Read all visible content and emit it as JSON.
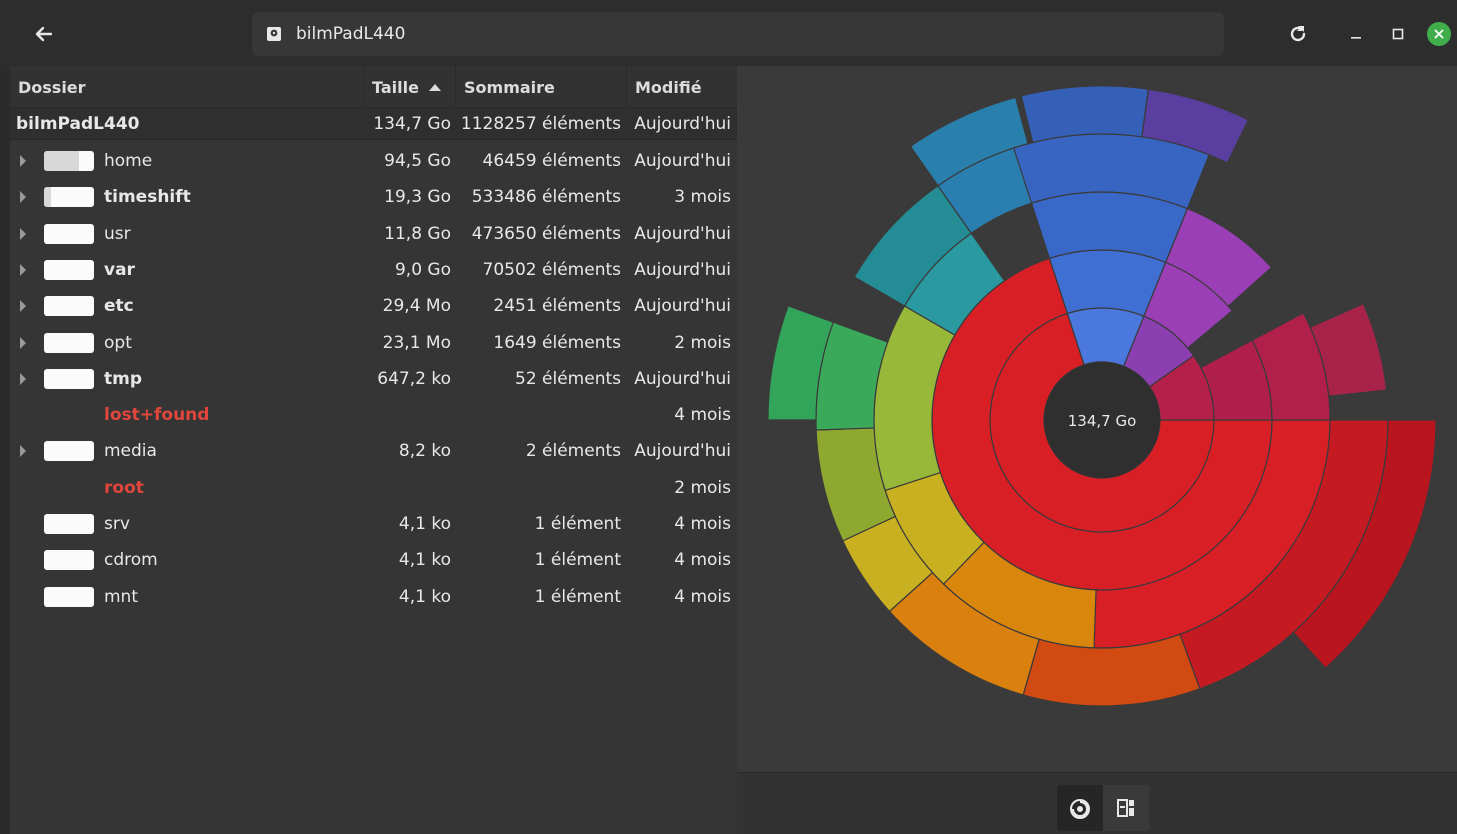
{
  "header": {
    "location": "bilmPadL440",
    "icons": {
      "back": "arrow-left-icon",
      "disk": "disk-icon",
      "reload": "reload-icon",
      "minimize": "minimize-icon",
      "maximize": "maximize-icon",
      "close": "close-icon"
    },
    "close_color": "#3fae4a"
  },
  "columns": {
    "name": "Dossier",
    "size": "Taille",
    "summary": "Sommaire",
    "modified": "Modifié"
  },
  "root": {
    "name": "bilmPadL440",
    "size": "134,7 Go",
    "summary": "1128257 éléments",
    "modified": "Aujourd'hui"
  },
  "rows": [
    {
      "name": "home",
      "size": "94,5 Go",
      "summary": "46459 éléments",
      "modified": "Aujourd'hui",
      "bold": false,
      "error": false,
      "expandable": true,
      "bar": true,
      "fill": 0.7
    },
    {
      "name": "timeshift",
      "size": "19,3 Go",
      "summary": "533486 éléments",
      "modified": "3 mois",
      "bold": true,
      "error": false,
      "expandable": true,
      "bar": true,
      "fill": 0.14
    },
    {
      "name": "usr",
      "size": "11,8 Go",
      "summary": "473650 éléments",
      "modified": "Aujourd'hui",
      "bold": false,
      "error": false,
      "expandable": true,
      "bar": true,
      "fill": 0.0
    },
    {
      "name": "var",
      "size": "9,0 Go",
      "summary": "70502 éléments",
      "modified": "Aujourd'hui",
      "bold": true,
      "error": false,
      "expandable": true,
      "bar": true,
      "fill": 0.0
    },
    {
      "name": "etc",
      "size": "29,4 Mo",
      "summary": "2451 éléments",
      "modified": "Aujourd'hui",
      "bold": true,
      "error": false,
      "expandable": true,
      "bar": true,
      "fill": 0.0
    },
    {
      "name": "opt",
      "size": "23,1 Mo",
      "summary": "1649 éléments",
      "modified": "2 mois",
      "bold": false,
      "error": false,
      "expandable": true,
      "bar": true,
      "fill": 0.0
    },
    {
      "name": "tmp",
      "size": "647,2 ko",
      "summary": "52 éléments",
      "modified": "Aujourd'hui",
      "bold": true,
      "error": false,
      "expandable": true,
      "bar": true,
      "fill": 0.0
    },
    {
      "name": "lost+found",
      "size": "",
      "summary": "",
      "modified": "4 mois",
      "bold": true,
      "error": true,
      "expandable": false,
      "bar": false,
      "fill": 0.0
    },
    {
      "name": "media",
      "size": "8,2 ko",
      "summary": "2 éléments",
      "modified": "Aujourd'hui",
      "bold": false,
      "error": false,
      "expandable": true,
      "bar": true,
      "fill": 0.0
    },
    {
      "name": "root",
      "size": "",
      "summary": "",
      "modified": "2 mois",
      "bold": true,
      "error": true,
      "expandable": false,
      "bar": false,
      "fill": 0.0
    },
    {
      "name": "srv",
      "size": "4,1 ko",
      "summary": "1 élément",
      "modified": "4 mois",
      "bold": false,
      "error": false,
      "expandable": false,
      "bar": true,
      "fill": 0.0
    },
    {
      "name": "cdrom",
      "size": "4,1 ko",
      "summary": "1 élément",
      "modified": "4 mois",
      "bold": false,
      "error": false,
      "expandable": false,
      "bar": true,
      "fill": 0.0
    },
    {
      "name": "mnt",
      "size": "4,1 ko",
      "summary": "1 élément",
      "modified": "4 mois",
      "bold": false,
      "error": false,
      "expandable": false,
      "bar": true,
      "fill": 0.0
    }
  ],
  "chart": {
    "center_label": "134,7 Go",
    "colors": {
      "red": "#d91f26",
      "blue": "#3e6fcf",
      "purple": "#8b3fb0",
      "magenta": "#b5204a",
      "teal": "#2a9aa0",
      "green": "#3aa95a",
      "olive": "#98b83a",
      "yellow": "#c9b020",
      "orange": "#d9800f"
    }
  },
  "toggles": {
    "chart_icon": "ring-chart-icon",
    "treemap_icon": "treemap-icon"
  }
}
